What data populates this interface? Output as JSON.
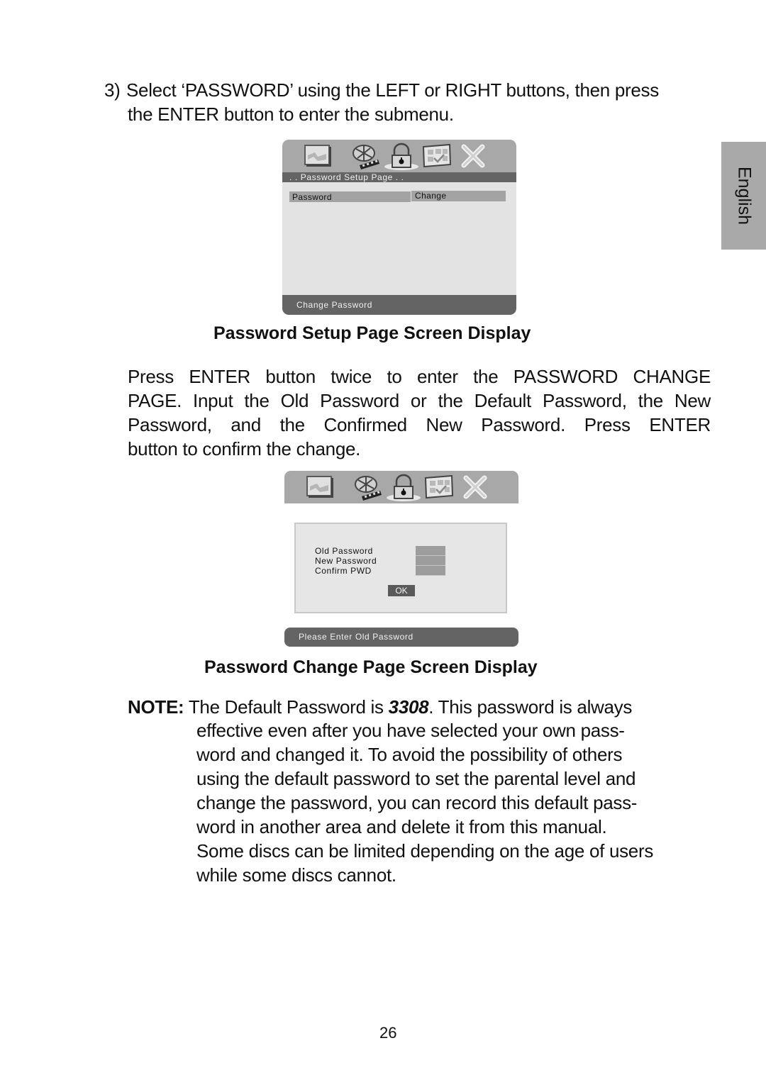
{
  "step": {
    "number": "3)",
    "line1": "Select ‘PASSWORD’ using the  LEFT or RIGHT buttons, then press",
    "line2": "the ENTER button to enter the submenu."
  },
  "language_tab": {
    "label": "English"
  },
  "screen1": {
    "icons": [
      "picture-icon",
      "film-reel-icon",
      "padlock-icon",
      "preferences-grid-icon",
      "close-x-icon"
    ],
    "selected_icon": "padlock-icon",
    "subtitle": ". . Password  Setup  Page . .",
    "rows": [
      {
        "label": "Password",
        "value": "Change"
      }
    ],
    "footer": "Change  Password"
  },
  "caption1": "Password Setup Page Screen Display",
  "paragraph": {
    "lines": [
      "Press ENTER button twice to enter the PASSWORD CHANGE",
      "PAGE. Input the Old  Password or the Default Password, the New",
      "Password, and the Confirmed New Password. Press ENTER",
      "button to confirm the change."
    ]
  },
  "screen2": {
    "icons": [
      "picture-icon",
      "film-reel-icon",
      "padlock-icon",
      "preferences-grid-icon",
      "close-x-icon"
    ],
    "selected_icon": "padlock-icon",
    "fields": [
      {
        "label": "Old  Password",
        "value": ""
      },
      {
        "label": "New  Password",
        "value": ""
      },
      {
        "label": "Confirm  PWD",
        "value": ""
      }
    ],
    "ok_label": "OK",
    "footer": "Please  Enter  Old  Password"
  },
  "caption2": "Password Change Page Screen Display",
  "note": {
    "label": "NOTE:",
    "intro": " The Default Password is ",
    "default_password": "3308",
    "intro_end": ".  This password is always",
    "lines": [
      "effective even after you have selected your own pass-",
      "word and changed it. To avoid  the possibility of others",
      "using the default password to set the parental level and",
      "change the password, you can record this default pass-",
      "word in another area and delete it from this manual.",
      "Some discs can be limited depending on the age of users",
      "while some discs cannot."
    ]
  },
  "page_number": "26"
}
